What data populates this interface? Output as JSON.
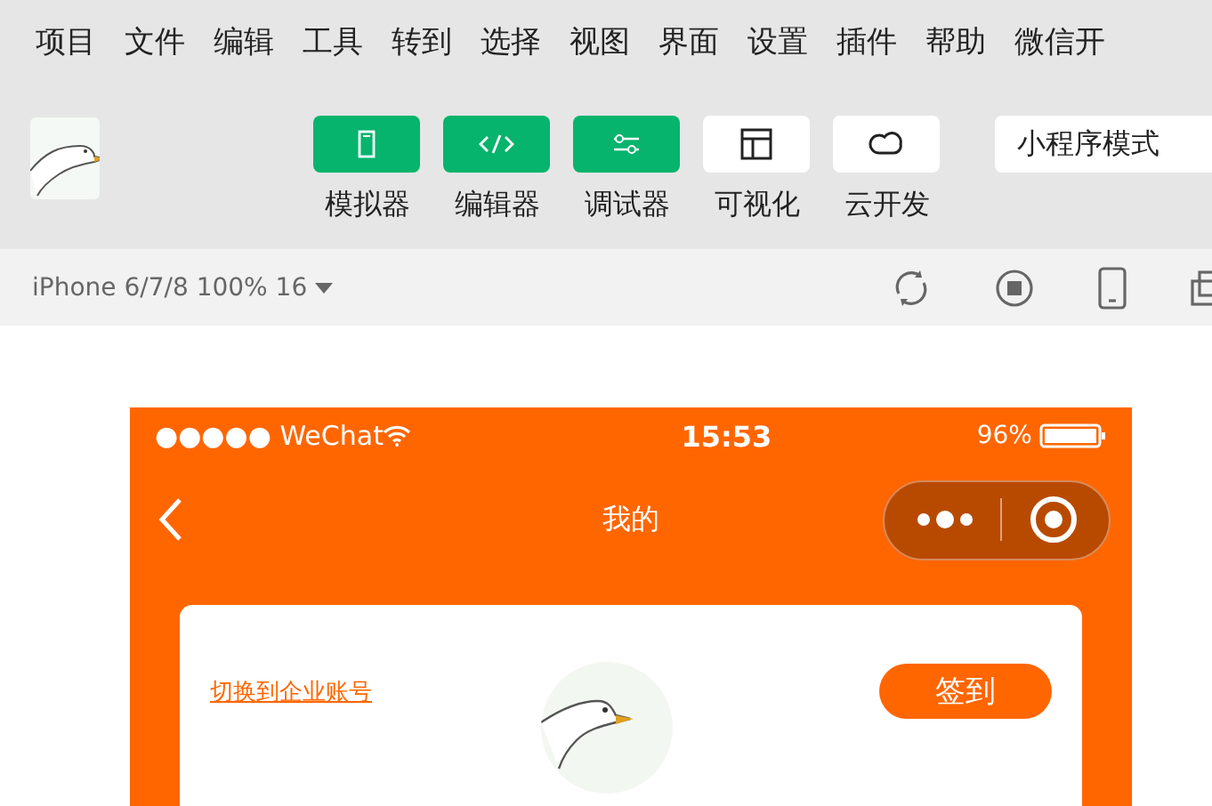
{
  "menu": [
    "项目",
    "文件",
    "编辑",
    "工具",
    "转到",
    "选择",
    "视图",
    "界面",
    "设置",
    "插件",
    "帮助",
    "微信开"
  ],
  "toolbar": [
    {
      "kind": "phone",
      "label": "模拟器",
      "active": true
    },
    {
      "kind": "code",
      "label": "编辑器",
      "active": true
    },
    {
      "kind": "sliders",
      "label": "调试器",
      "active": true
    },
    {
      "kind": "layout",
      "label": "可视化",
      "active": false
    },
    {
      "kind": "cloud",
      "label": "云开发",
      "active": false
    }
  ],
  "mode_select": {
    "value": "小程序模式"
  },
  "device_bar": {
    "device": "iPhone 6/7/8 100% 16"
  },
  "phone": {
    "carrier": "●●●●● WeChat",
    "time": "15:53",
    "battery": "96%",
    "title": "我的",
    "card": {
      "link": "切换到企业账号",
      "button": "签到"
    }
  }
}
